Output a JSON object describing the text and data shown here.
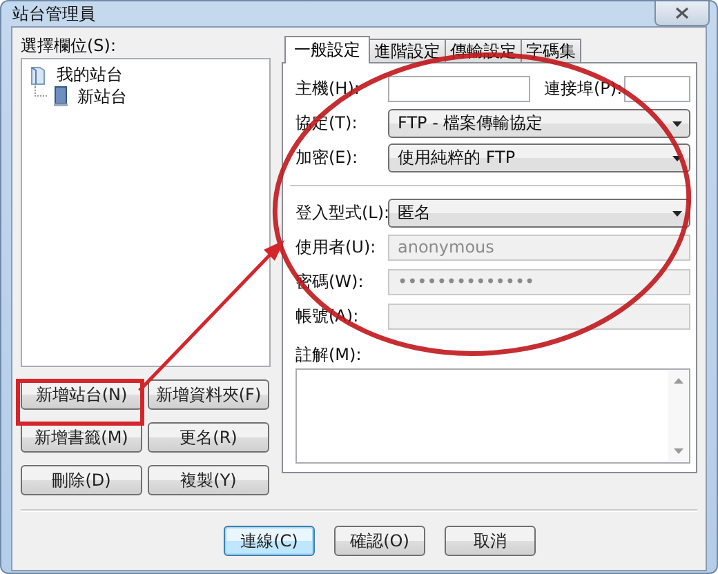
{
  "window": {
    "title": "站台管理員"
  },
  "site_list": {
    "label": "選擇欄位(S):",
    "tree": [
      {
        "label": "我的站台",
        "selected": false,
        "children": [
          {
            "label": "新站台",
            "selected": false
          }
        ]
      }
    ]
  },
  "site_buttons": [
    {
      "label": "新增站台(N)"
    },
    {
      "label": "新增資料夾(F)"
    },
    {
      "label": "新增書籤(M)"
    },
    {
      "label": "更名(R)"
    },
    {
      "label": "刪除(D)"
    },
    {
      "label": "複製(Y)"
    }
  ],
  "tabs": [
    {
      "label": "一般設定",
      "selected": true
    },
    {
      "label": "進階設定",
      "selected": false
    },
    {
      "label": "傳輸設定",
      "selected": false
    },
    {
      "label": "字碼集",
      "selected": false
    }
  ],
  "host": {
    "label": "主機(H):"
  },
  "port": {
    "label": "連接埠(P):"
  },
  "connection_fields": [
    {
      "kind": "select",
      "label": "協定(T):",
      "value": "FTP - 檔案傳輸協定",
      "disabled": false
    },
    {
      "kind": "select",
      "label": "加密(E):",
      "value": "使用純粹的 FTP",
      "disabled": false
    }
  ],
  "login_fields": [
    {
      "kind": "select",
      "label": "登入型式(L):",
      "value": "匿名",
      "disabled": false
    },
    {
      "kind": "text",
      "label": "使用者(U):",
      "value": "anonymous",
      "disabled": true
    },
    {
      "kind": "text",
      "label": "密碼(W):",
      "value": "••••••••••••••",
      "disabled": true
    },
    {
      "kind": "text",
      "label": "帳號(A):",
      "disabled": true
    }
  ],
  "comments": {
    "label": "註解(M):"
  },
  "buttons": [
    {
      "label": "連線(C)",
      "default": true
    },
    {
      "label": "確認(O)",
      "default": false
    },
    {
      "label": "取消",
      "default": false
    }
  ]
}
